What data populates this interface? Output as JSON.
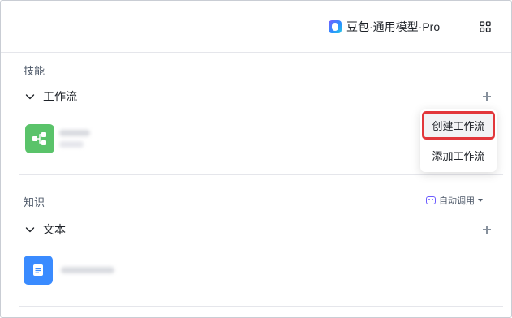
{
  "header": {
    "model_label": "豆包·通用模型·Pro"
  },
  "icons": {
    "model_logo": "doubao-logo-icon",
    "settings_grid": "grid-icon"
  },
  "skills": {
    "title": "技能",
    "workflow_label": "工作流"
  },
  "knowledge": {
    "title": "知识",
    "auto_call_label": "自动调用",
    "text_label": "文本"
  },
  "popup": {
    "items": [
      "创建工作流",
      "添加工作流"
    ]
  },
  "colors": {
    "highlight_border": "#e2373b",
    "workflow_tile": "#5ac36a",
    "doc_tile": "#3a8bff",
    "accent": "#6c5cff"
  }
}
